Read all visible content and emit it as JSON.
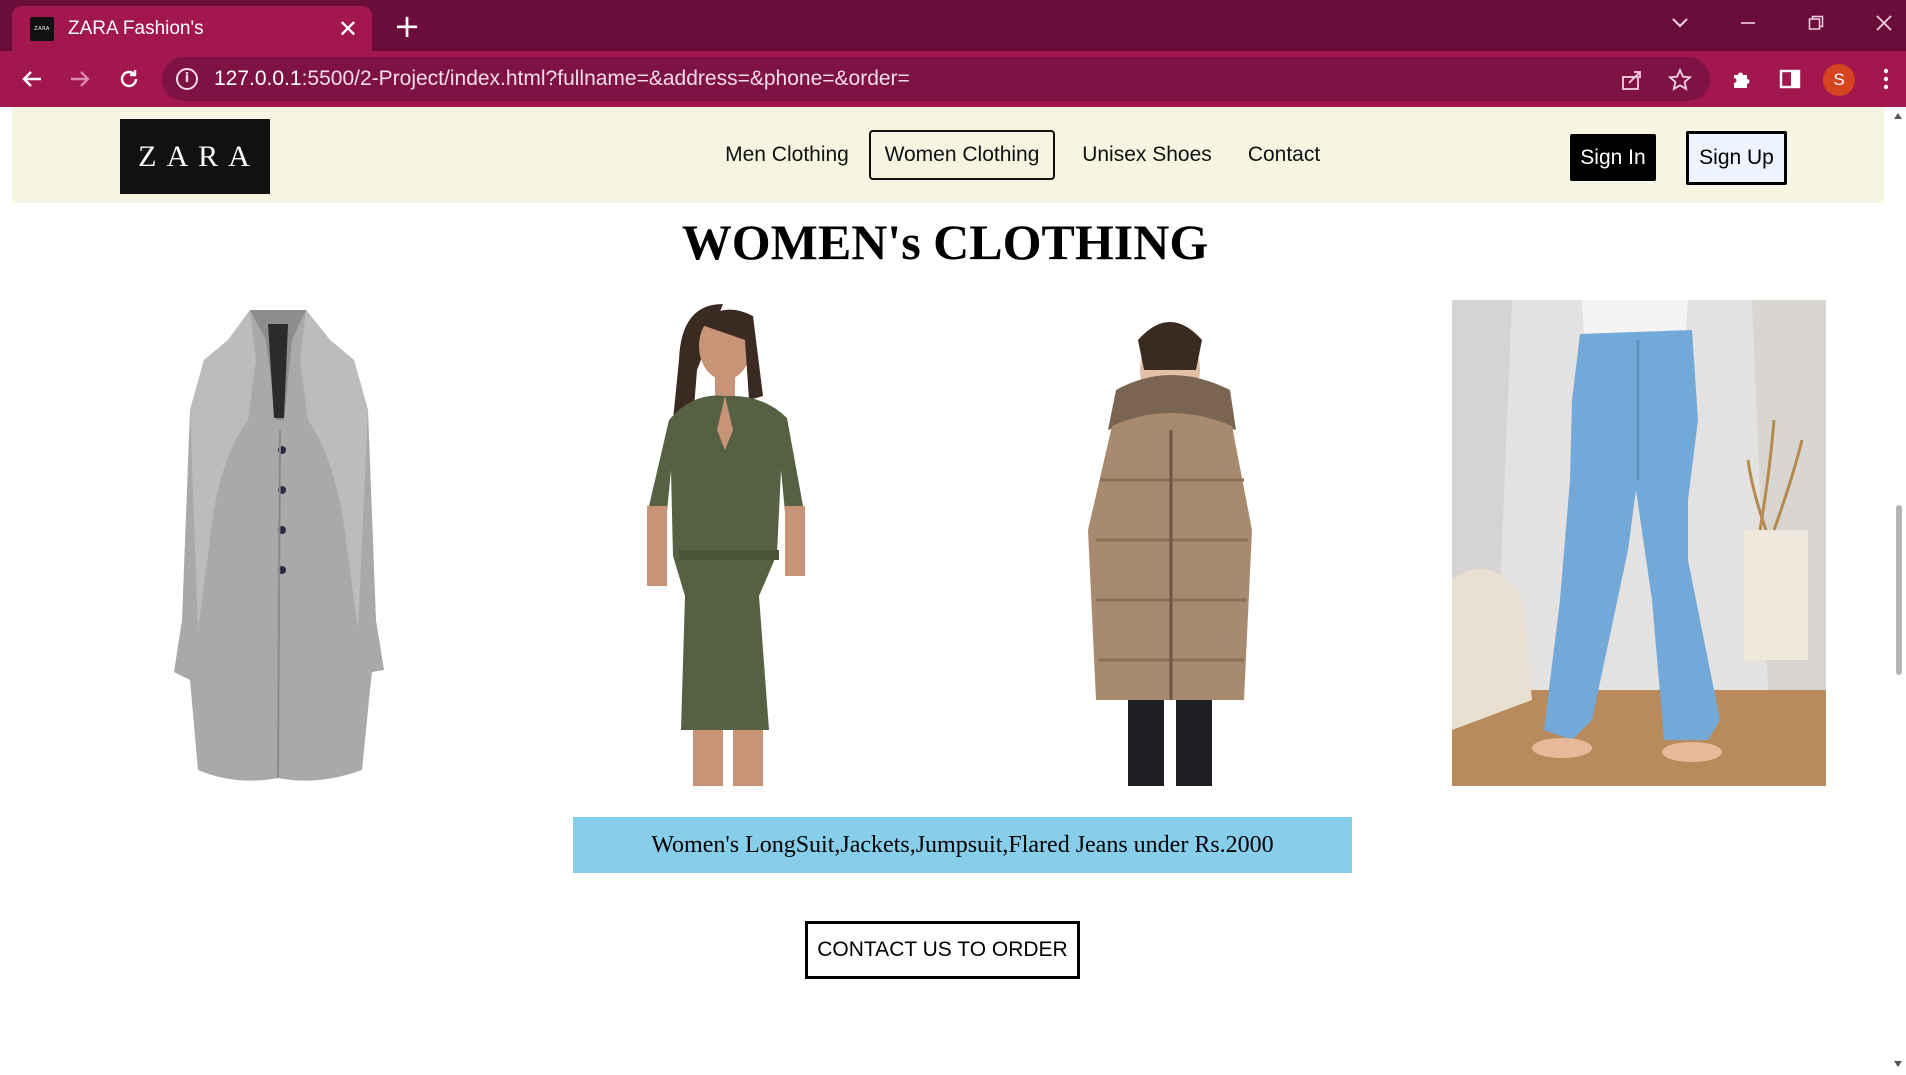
{
  "browser": {
    "tab_title": "ZARA Fashion's",
    "favicon_text": "ZARA",
    "url_host": "127.0.0.1",
    "url_rest": ":5500/2-Project/index.html?fullname=&address=&phone=&order=",
    "profile_initial": "S",
    "theme_color": "#a3174f",
    "frame_color": "#6a0d3a"
  },
  "header": {
    "logo_text": "ZARA",
    "nav": [
      {
        "label": "Men Clothing",
        "active": false
      },
      {
        "label": "Women Clothing",
        "active": true
      },
      {
        "label": "Unisex Shoes",
        "active": false
      },
      {
        "label": "Contact",
        "active": false
      }
    ],
    "sign_in": "Sign In",
    "sign_up": "Sign Up",
    "background": "#f5f5e1"
  },
  "main": {
    "title": "WOMEN's CLOTHING",
    "products": [
      {
        "name": "grey-long-coat"
      },
      {
        "name": "olive-jumpsuit"
      },
      {
        "name": "beige-puffer-jacket"
      },
      {
        "name": "blue-flared-jeans"
      }
    ],
    "promo_text": "Women's LongSuit,Jackets,Jumpsuit,Flared Jeans under Rs.2000",
    "promo_color": "#87ceeb",
    "order_button": "CONTACT US TO ORDER"
  }
}
